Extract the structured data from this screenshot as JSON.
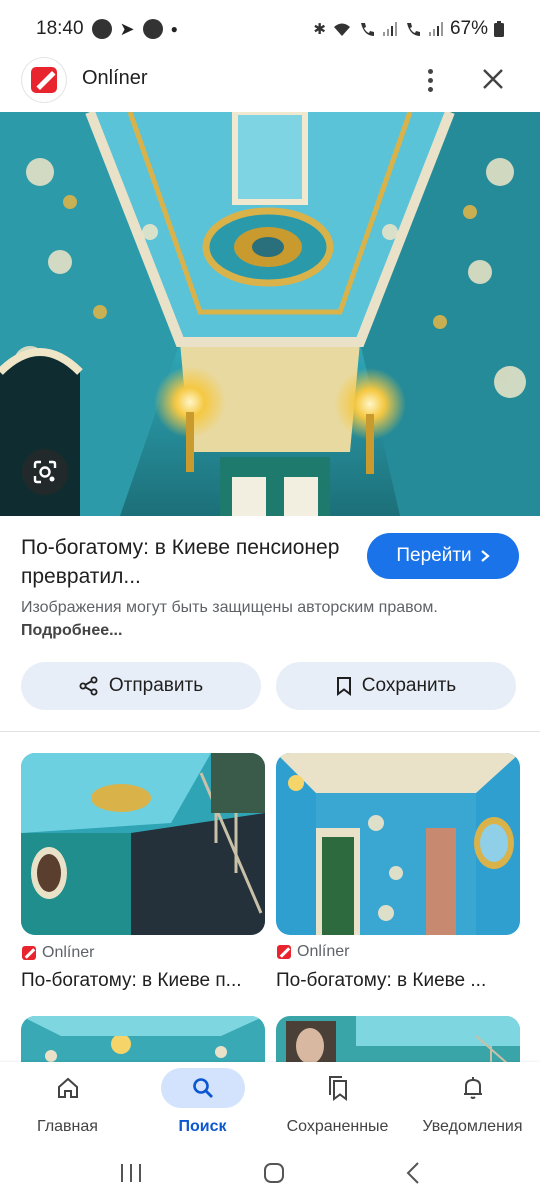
{
  "status_bar": {
    "time": "18:40",
    "battery": "67%",
    "left_icons": [
      "messenger-icon",
      "telegram-icon",
      "messenger-icon"
    ],
    "right_icons": [
      "bluetooth-icon",
      "wifi-icon",
      "wifi-calling-icon",
      "signal-icon",
      "wifi-calling-2-icon",
      "signal-icon",
      "battery-icon"
    ]
  },
  "header": {
    "site_name": "Onlíner"
  },
  "result": {
    "title": "По-богатому: в Киеве пенсионер превратил...",
    "open_button": "Перейти",
    "copyright_text": "Изображения могут быть защищены авторским правом.",
    "more_link": "Подробнее..."
  },
  "actions": {
    "share": "Отправить",
    "save": "Сохранить"
  },
  "related": [
    {
      "source": "Onlíner",
      "title": "По-богатому: в Киеве п..."
    },
    {
      "source": "Onlíner",
      "title": "По-богатому: в Киеве ..."
    }
  ],
  "bottom_nav": [
    {
      "label": "Главная",
      "icon": "home-icon",
      "active": false
    },
    {
      "label": "Поиск",
      "icon": "search-icon",
      "active": true
    },
    {
      "label": "Сохраненные",
      "icon": "saved-icon",
      "active": false
    },
    {
      "label": "Уведомления",
      "icon": "bell-icon",
      "active": false
    }
  ],
  "colors": {
    "accent": "#1a73e8",
    "brand": "#e8252e",
    "active_nav": "#0b57d0",
    "chip_bg": "#e8eef8"
  }
}
